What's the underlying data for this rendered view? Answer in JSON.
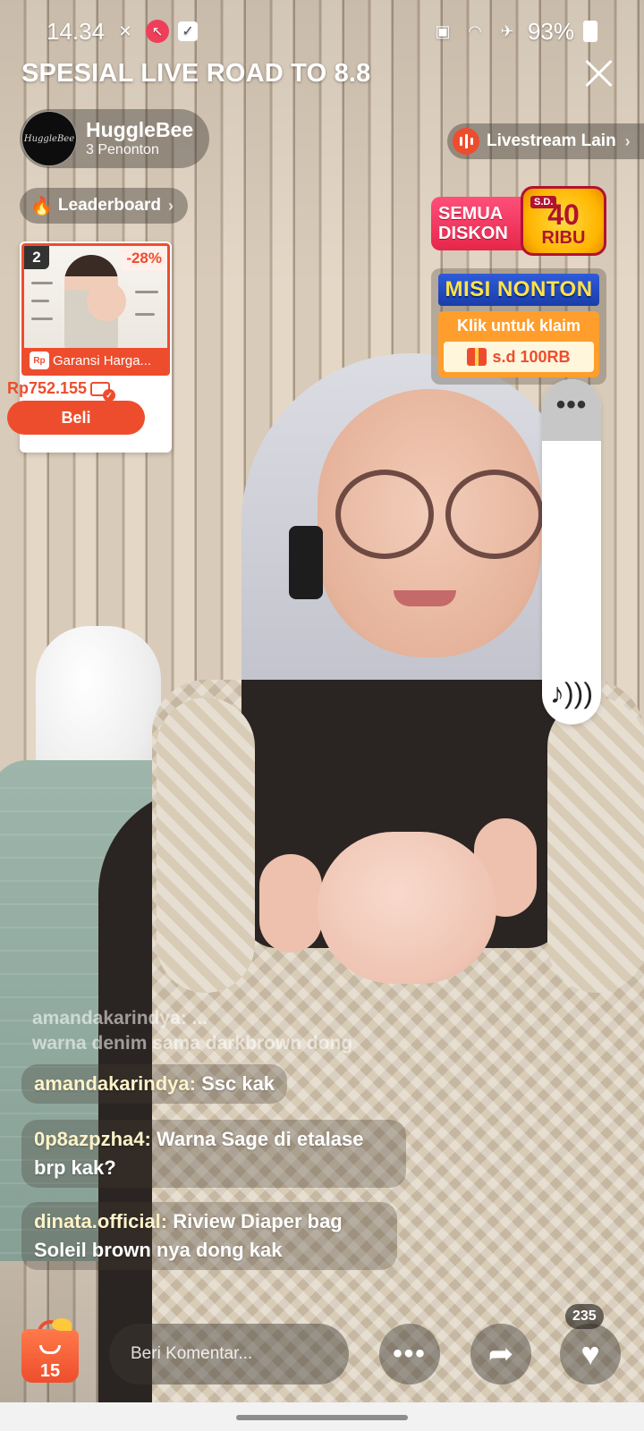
{
  "status_bar": {
    "time": "14.34",
    "battery": "93%",
    "left_icons": [
      "notification-icon",
      "shopee-icon",
      "check-box-icon"
    ],
    "right_icons": [
      "battery-saver-icon",
      "wifi-icon",
      "airplane-icon"
    ]
  },
  "live": {
    "title": "SPESIAL LIVE ROAD TO 8.8"
  },
  "host": {
    "name": "HuggleBee",
    "viewers": "3 Penonton",
    "avatar_text": "HuggleBee"
  },
  "leaderboard": {
    "label": "Leaderboard"
  },
  "other_live": {
    "label": "Livestream Lain"
  },
  "product": {
    "rank": "2",
    "discount": "-28%",
    "guarantee": "Garansi Harga...",
    "rp_badge": "Rp",
    "price": "Rp752.155",
    "buy_label": "Beli"
  },
  "promo": {
    "discount_line1": "SEMUA",
    "discount_line2": "DISKON",
    "discount_sd": "S.D.",
    "discount_amount": "40",
    "discount_unit": "RIBU",
    "mission_title": "MISI NONTON",
    "mission_claim": "Klik untuk klaim",
    "mission_reward": "s.d 100RB"
  },
  "volume": {
    "level": 0.82,
    "menu": "•••",
    "note": "♪)))"
  },
  "chat": {
    "faded_line1": "amandakarindya: ...",
    "faded_line2": "warna denim sama darkbrown dong",
    "messages": [
      {
        "user": "amandakarindya:",
        "text": " Ssc kak"
      },
      {
        "user": "0p8azpzha4:",
        "text": " Warna Sage di etalase brp kak?"
      },
      {
        "user": "dinata.official:",
        "text": " Riview Diaper bag Soleil brown nya dong kak"
      }
    ]
  },
  "bottom_bar": {
    "cart_count": "15",
    "comment_placeholder": "Beri Komentar...",
    "more_label": "•••",
    "like_count": "235"
  },
  "colors": {
    "shopee_orange": "#ee4d2d",
    "promo_pink": "#e6264b",
    "promo_gold": "#ffb400",
    "mission_blue": "#1a3ea8"
  }
}
